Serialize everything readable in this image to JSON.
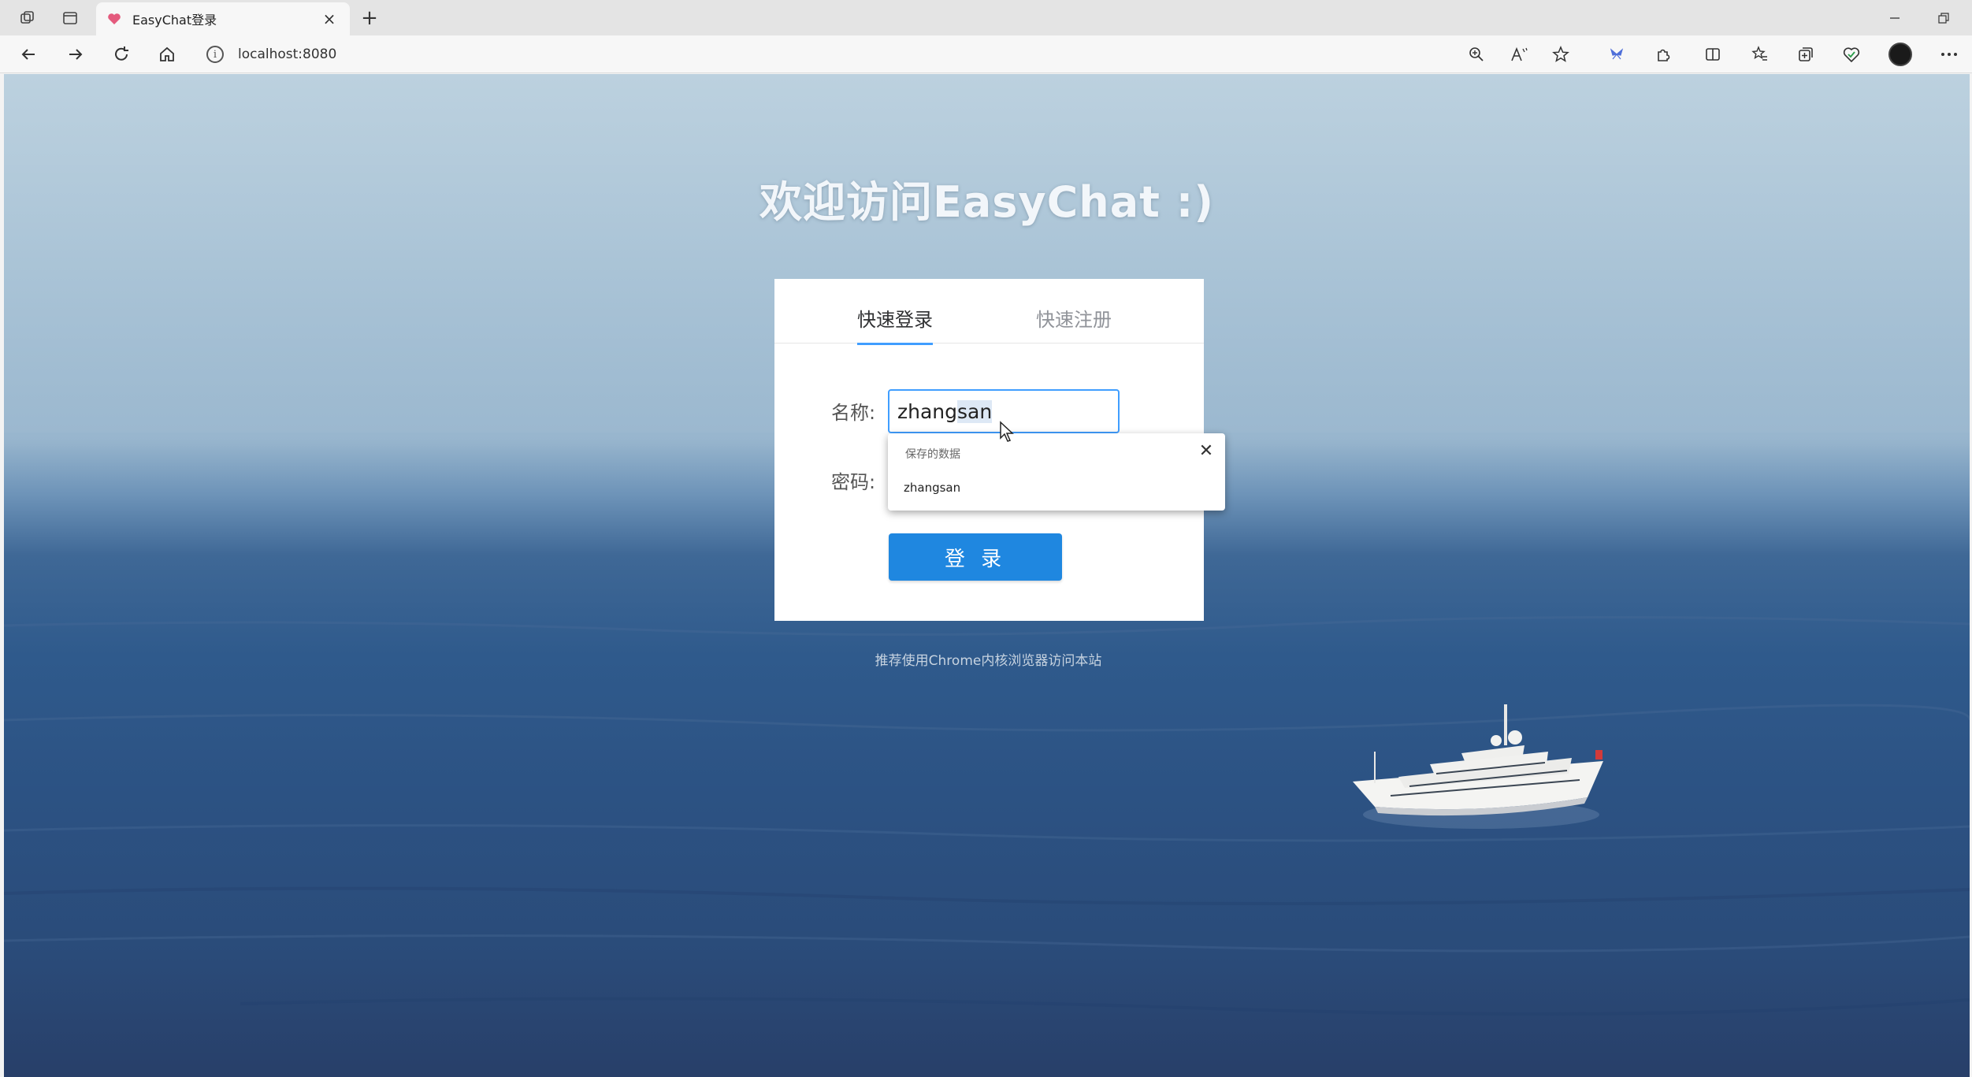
{
  "browser": {
    "tab_title": "EasyChat登录",
    "url": "localhost:8080",
    "new_tab_symbol": "+",
    "tab_close_symbol": "×"
  },
  "page": {
    "welcome": "欢迎访问EasyChat :)",
    "tabs": {
      "login": "快速登录",
      "register": "快速注册"
    },
    "form": {
      "name_label": "名称:",
      "name_value_typed": "zhang",
      "name_value_selected": "san",
      "password_label": "密码:",
      "login_button": "登 录"
    },
    "hint": "推荐使用Chrome内核浏览器访问本站"
  },
  "autofill": {
    "header": "保存的数据",
    "item": "zhangsan",
    "close_symbol": "✕"
  },
  "colors": {
    "accent": "#409eff",
    "button": "#1f87e0"
  }
}
